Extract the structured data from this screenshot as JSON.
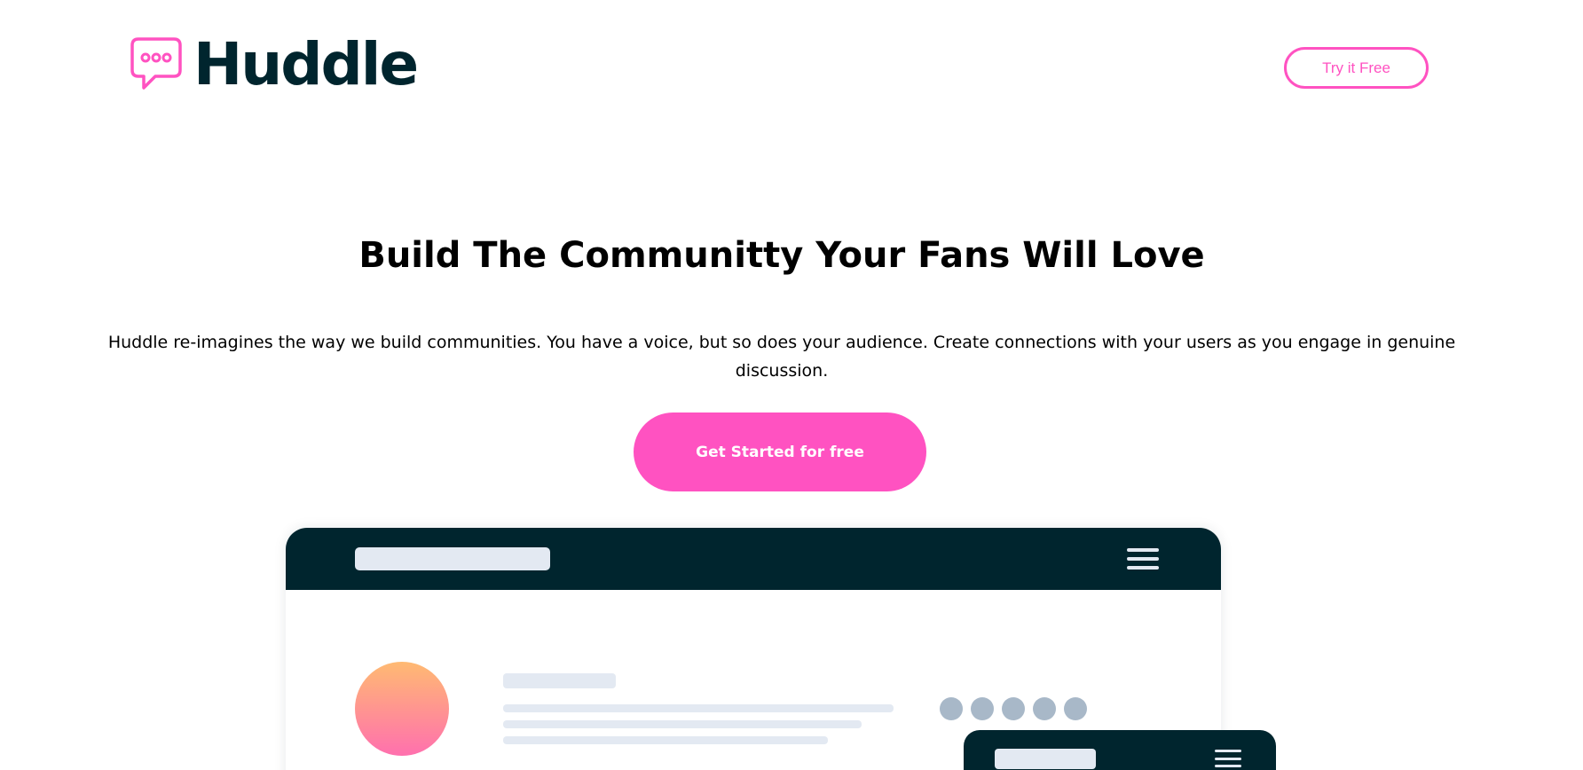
{
  "header": {
    "logo_text": "Huddle",
    "logo_icon": "chat-bubble-icon",
    "try_button": "Try it Free"
  },
  "hero": {
    "title": "Build The Communitty Your Fans Will Love",
    "description": "Huddle re-imagines the way we build communities. You have a voice, but so does your audience. Create connections with your users as you engage in genuine discussion.",
    "cta_button": "Get Started for free"
  },
  "mockup": {
    "menu_icon": "hamburger-menu-icon",
    "dot_count": 5
  },
  "colors": {
    "brand_pink": "#ff52c1",
    "dark_navy": "#00252e",
    "skeleton": "#e3e9f2",
    "dot_gray": "#a8b8c8",
    "avatar_gradient_start": "#ffba72",
    "avatar_gradient_end": "#ff70ae"
  }
}
